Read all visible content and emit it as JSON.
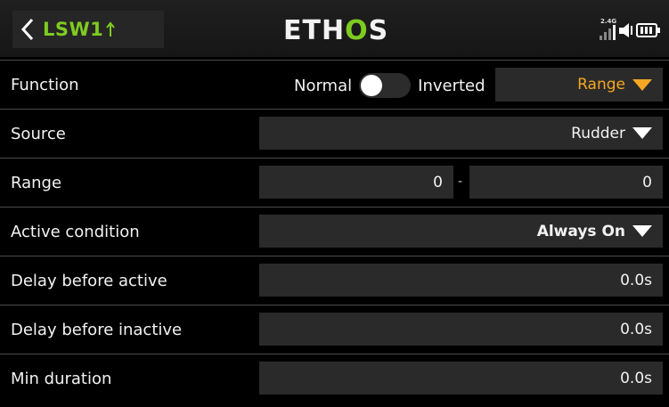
{
  "header": {
    "back_title": "LSW1",
    "logo_main": "ETH",
    "logo_accent": "O",
    "logo_tail": "S",
    "signal_label": "2.4G",
    "icons": [
      "back-chevron-icon",
      "sort-arrow-icon",
      "signal-bars-icon",
      "speaker-icon",
      "battery-icon"
    ]
  },
  "rows": {
    "function": {
      "label": "Function",
      "toggle_left": "Normal",
      "toggle_right": "Inverted",
      "toggle_on": false,
      "value": "Range"
    },
    "source": {
      "label": "Source",
      "value": "Rudder"
    },
    "range": {
      "label": "Range",
      "min": "0",
      "max": "0"
    },
    "active_condition": {
      "label": "Active condition",
      "value": "Always On"
    },
    "delay_active": {
      "label": "Delay before active",
      "value": "0.0s"
    },
    "delay_inactive": {
      "label": "Delay before inactive",
      "value": "0.0s"
    },
    "min_duration": {
      "label": "Min duration",
      "value": "0.0s"
    }
  },
  "colors": {
    "accent_green": "#7ecb20",
    "accent_orange": "#f5a623",
    "field_bg": "#2a2a2a"
  }
}
